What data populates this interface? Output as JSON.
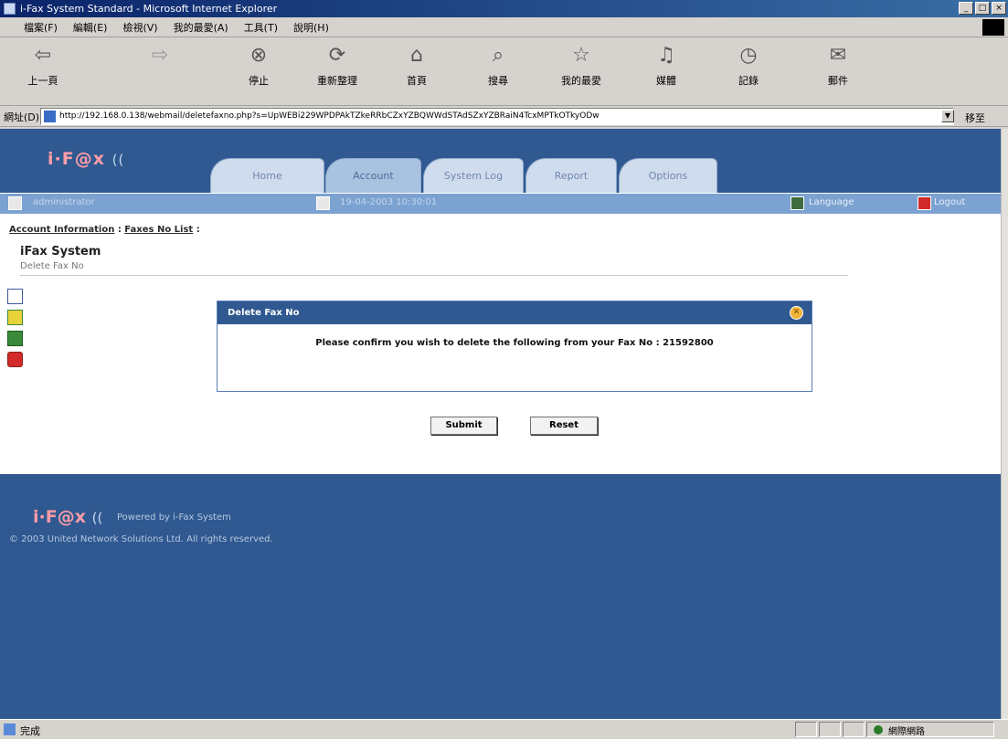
{
  "window": {
    "title": "i-Fax System Standard - Microsoft Internet Explorer",
    "buttons": [
      "_",
      "□",
      "×"
    ]
  },
  "menu": [
    "檔案(F)",
    "編輯(E)",
    "檢視(V)",
    "我的最愛(A)",
    "工具(T)",
    "說明(H)"
  ],
  "toolbar": [
    {
      "label": "上一頁",
      "icon": "back-icon",
      "glyph": "⇦",
      "enabled": true
    },
    {
      "label": "",
      "icon": "forward-icon",
      "glyph": "⇨",
      "enabled": false
    },
    {
      "label": "停止",
      "icon": "stop-icon",
      "glyph": "⊗",
      "enabled": true
    },
    {
      "label": "重新整理",
      "icon": "refresh-icon",
      "glyph": "⟳",
      "enabled": true
    },
    {
      "label": "首頁",
      "icon": "home-icon",
      "glyph": "⌂",
      "enabled": true
    },
    {
      "label": "搜尋",
      "icon": "search-icon",
      "glyph": "⌕",
      "enabled": true
    },
    {
      "label": "我的最愛",
      "icon": "favorites-icon",
      "glyph": "☆",
      "enabled": true
    },
    {
      "label": "媒體",
      "icon": "media-icon",
      "glyph": "♫",
      "enabled": true
    },
    {
      "label": "記錄",
      "icon": "history-icon",
      "glyph": "◷",
      "enabled": true
    },
    {
      "label": "郵件",
      "icon": "mail-icon",
      "glyph": "✉",
      "enabled": true
    }
  ],
  "address": {
    "label": "網址(D)",
    "url": "http://192.168.0.138/webmail/deletefaxno.php?s=UpWEBi229WPDPAkTZkeRRbCZxYZBQWWdSTAdSZxYZBRaiN4TcxMPTkOTkyODw",
    "go_label": "移至"
  },
  "site": {
    "logo_text": "i·F@x",
    "logo_waves": "((",
    "tabs": [
      "Home",
      "Account",
      "System Log",
      "Report",
      "Options"
    ],
    "active_tab": "Account",
    "user": "administrator",
    "datetime": "19-04-2003 10:30:01",
    "language_label": "Language",
    "logout_label": "Logout"
  },
  "breadcrumb": {
    "link1": "Account Information",
    "link2": "Faxes No List",
    "separator": ":",
    "trailing": ":"
  },
  "page": {
    "title": "iFax System",
    "subtitle": "Delete Fax No"
  },
  "dialog": {
    "title": "Delete Fax No",
    "message": "Please confirm you wish to delete the following from your Fax No : 21592800"
  },
  "buttons": {
    "submit": "Submit",
    "reset": "Reset"
  },
  "footer": {
    "powered_by": "Powered by i-Fax System",
    "copyright": "© 2003 United Network Solutions Ltd. All rights reserved."
  },
  "status": {
    "text": "完成",
    "zone": "網際網路"
  },
  "colors": {
    "header_bg": "#2f5990",
    "strip_bg": "#7ba2d0",
    "tab_bg": "#cfdced",
    "dialog_head": "#2f5990"
  }
}
